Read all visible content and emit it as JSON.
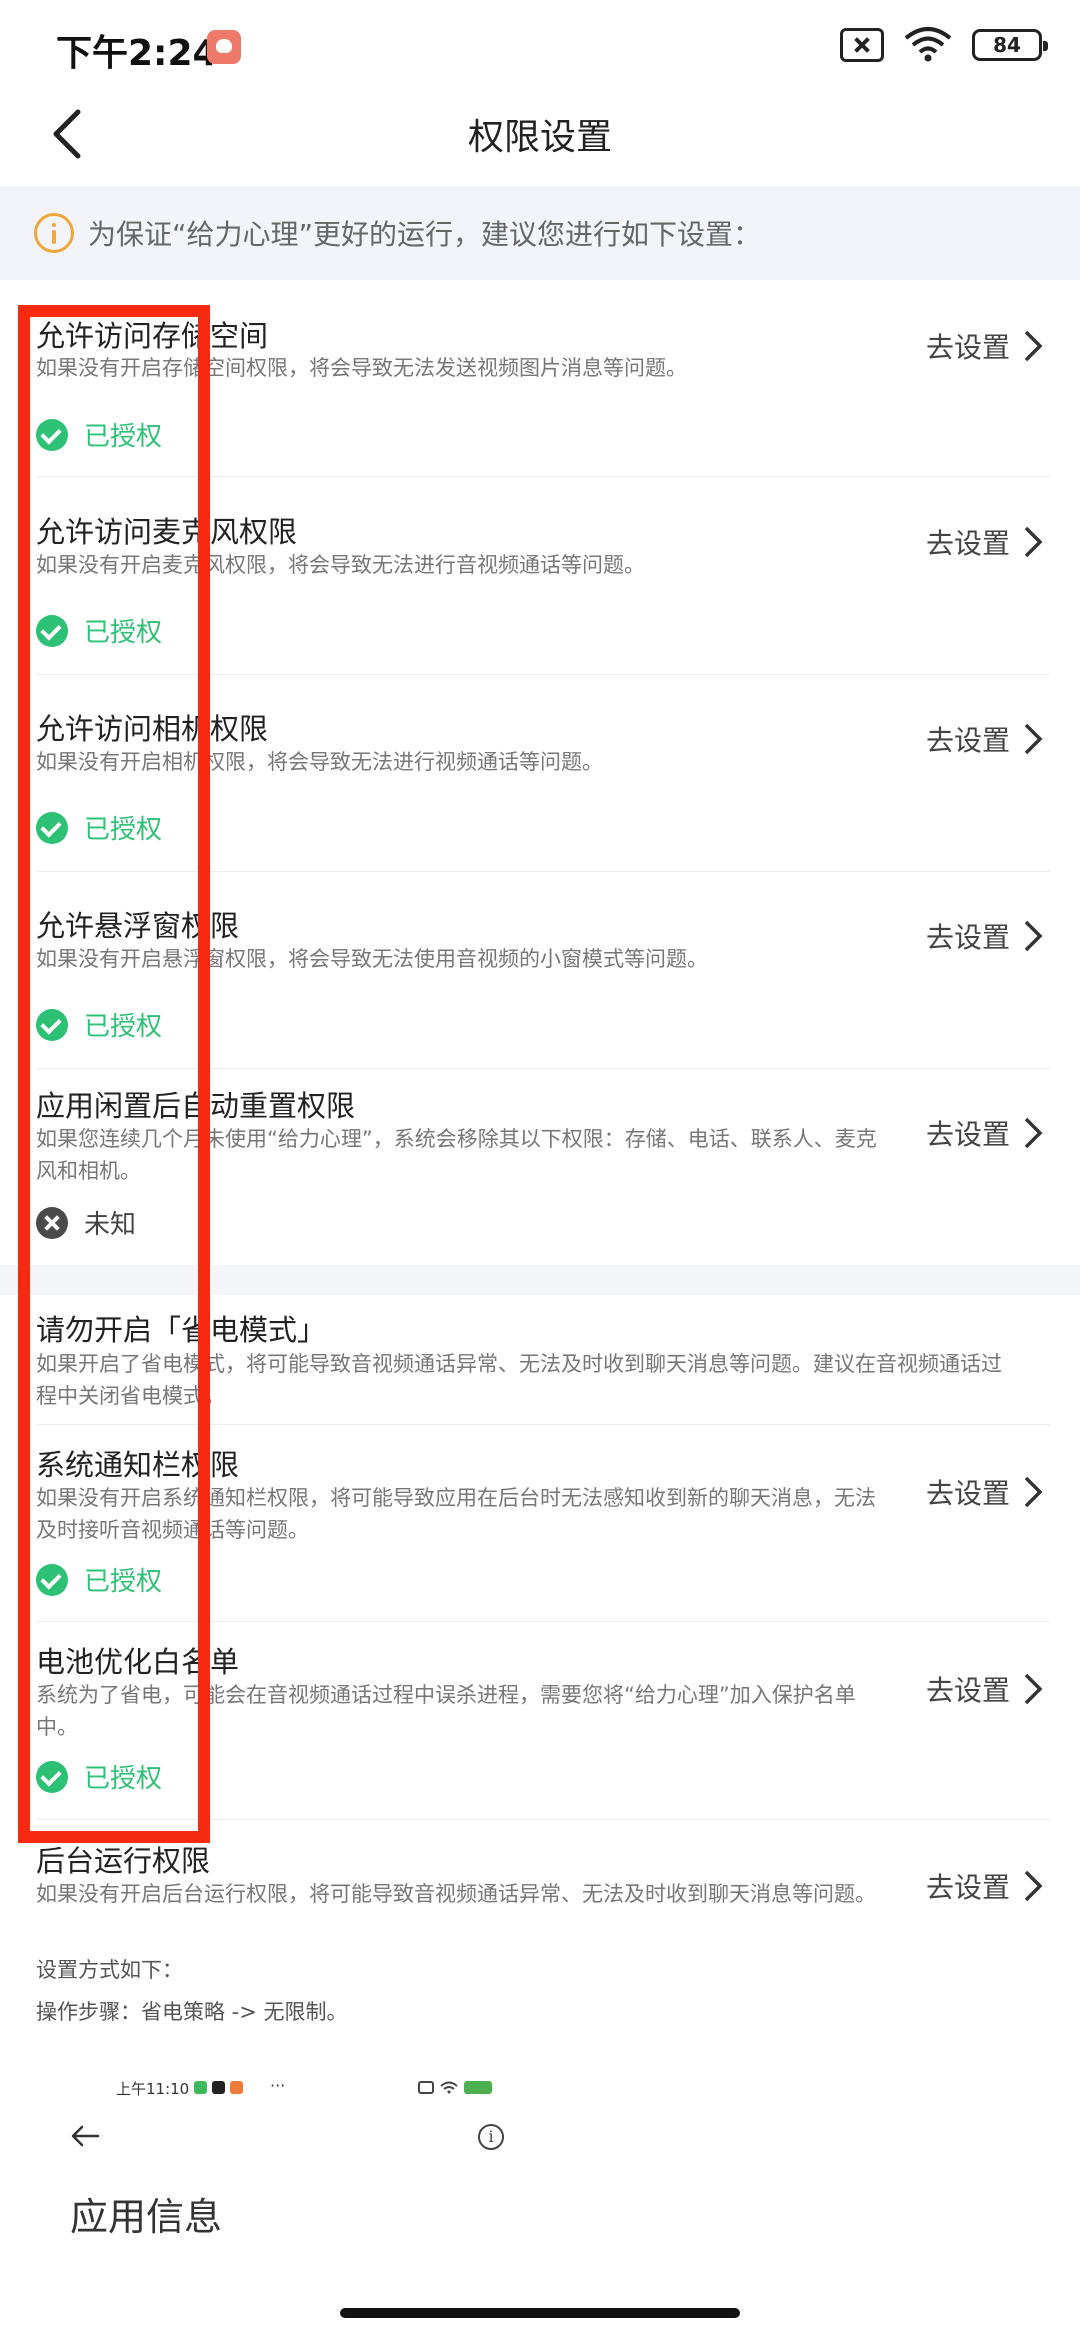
{
  "status_bar": {
    "time": "下午2:24",
    "battery": "84"
  },
  "nav": {
    "title": "权限设置"
  },
  "notice": {
    "text": "为保证“给力心理”更好的运行，建议您进行如下设置："
  },
  "go_label": "去设置",
  "items": [
    {
      "title": "允许访问存储空间",
      "desc": "如果没有开启存储空间权限，将会导致无法发送视频图片消息等问题。",
      "status": "已授权",
      "status_type": "ok"
    },
    {
      "title": "允许访问麦克风权限",
      "desc": "如果没有开启麦克风权限，将会导致无法进行音视频通话等问题。",
      "status": "已授权",
      "status_type": "ok"
    },
    {
      "title": "允许访问相机权限",
      "desc": "如果没有开启相机权限，将会导致无法进行视频通话等问题。",
      "status": "已授权",
      "status_type": "ok"
    },
    {
      "title": "允许悬浮窗权限",
      "desc": "如果没有开启悬浮窗权限，将会导致无法使用音视频的小窗模式等问题。",
      "status": "已授权",
      "status_type": "ok"
    },
    {
      "title": "应用闲置后自动重置权限",
      "desc": "如果您连续几个月未使用“给力心理”，系统会移除其以下权限：存储、电话、联系人、麦克风和相机。",
      "status": "未知",
      "status_type": "unk"
    },
    {
      "title": "请勿开启「省电模式」",
      "desc": "如果开启了省电模式，将可能导致音视频通话异常、无法及时收到聊天消息等问题。建议在音视频通话过程中关闭省电模式。"
    },
    {
      "title": "系统通知栏权限",
      "desc": "如果没有开启系统通知栏权限，将可能导致应用在后台时无法感知收到新的聊天消息，无法及时接听音视频通话等问题。",
      "status": "已授权",
      "status_type": "ok"
    },
    {
      "title": "电池优化白名单",
      "desc": "系统为了省电，可能会在音视频通话过程中误杀进程，需要您将“给力心理”加入保护名单中。",
      "status": "已授权",
      "status_type": "ok"
    },
    {
      "title": "后台运行权限",
      "desc": "如果没有开启后台运行权限，将可能导致音视频通话异常、无法及时收到聊天消息等问题。",
      "extra1": "设置方式如下：",
      "extra2": "操作步骤：省电策略 -> 无限制。"
    }
  ],
  "preview": {
    "time": "上午11:10",
    "dots": "···",
    "info": "i",
    "title": "应用信息"
  },
  "colors": {
    "granted": "#2cc174",
    "highlight_frame": "#f52a11",
    "notice_icon": "#f0a63a"
  }
}
